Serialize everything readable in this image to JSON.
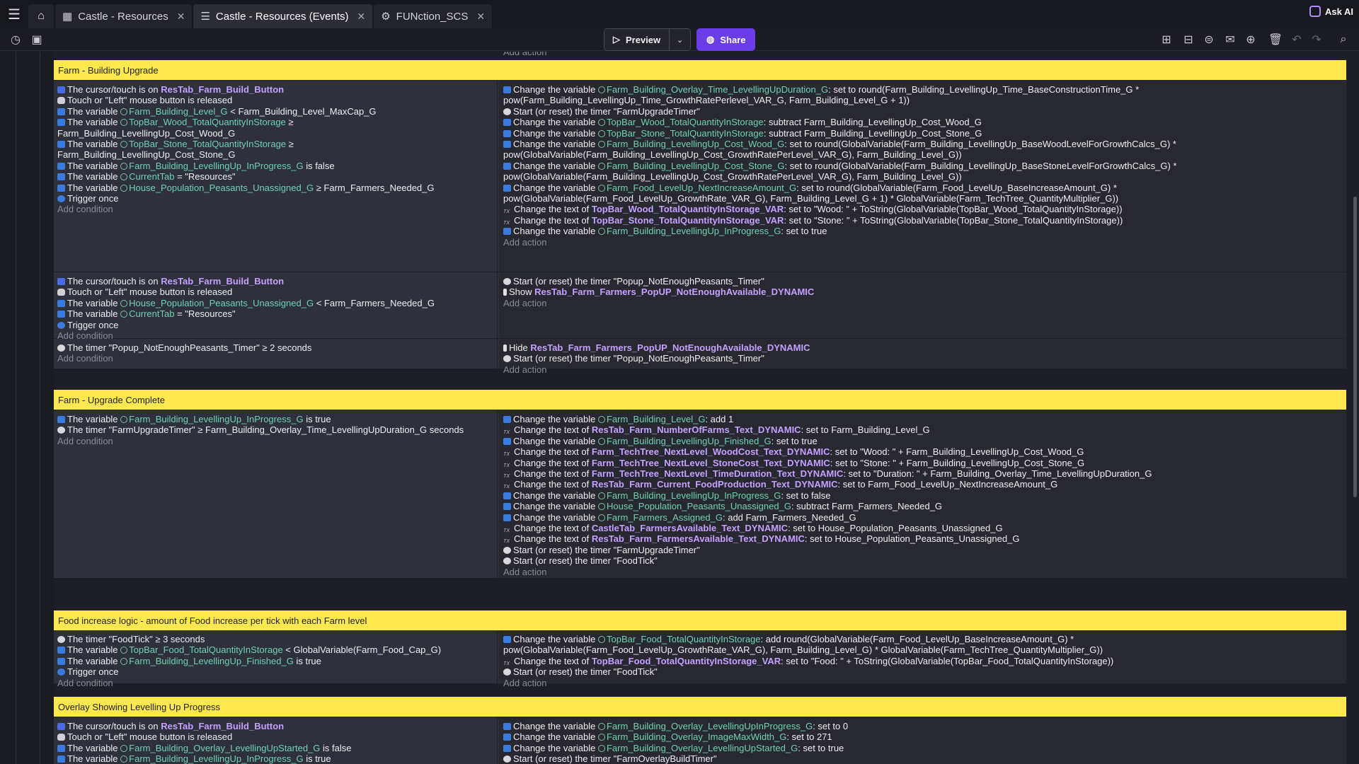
{
  "tabs": [
    {
      "label": "Castle - Resources",
      "active": false
    },
    {
      "label": "Castle - Resources (Events)",
      "active": true
    },
    {
      "label": "FUNction_SCS",
      "active": false
    }
  ],
  "header": {
    "ask_ai": "Ask AI"
  },
  "toolbar": {
    "preview": "Preview",
    "share": "Share",
    "ghost": "Add action"
  },
  "colors": {
    "comment_bg": "#fde84f",
    "share_bg": "#6a3de8",
    "object_name": "#c6a0ff",
    "variable_name": "#6fd3b0"
  },
  "events": {
    "c1": "Farm - Building Upgrade",
    "c2": "Farm - Upgrade Complete",
    "c3": "Food increase logic - amount of Food increase per tick with each Farm level",
    "c4": "Overlay Showing Levelling Up Progress",
    "e1": {
      "cond": [
        "The cursor/touch is on |ResTab_Farm_Build_Button",
        "Touch or \"Left\" mouse button is released",
        "The variable |Farm_Building_Level_G| < Farm_Building_Level_MaxCap_G",
        "The variable |TopBar_Wood_TotalQuantityInStorage| ≥",
        "Farm_Building_LevellingUp_Cost_Wood_G",
        "The variable |TopBar_Stone_TotalQuantityInStorage| ≥",
        "Farm_Building_LevellingUp_Cost_Stone_G",
        "The variable |Farm_Building_LevellingUp_InProgress_G| is false",
        "The variable |CurrentTab| = \"Resources\"",
        "The variable |House_Population_Peasants_Unassigned_G| ≥ Farm_Farmers_Needed_G",
        "Trigger once",
        "Add condition"
      ],
      "act": [
        "Change the variable |Farm_Building_Overlay_Time_LevellingUpDuration_G|: set to round(Farm_Building_LevellingUp_Time_BaseConstructionTime_G *",
        "pow(Farm_Building_LevellingUp_Time_GrowthRatePerlevel_VAR_G, Farm_Building_Level_G + 1))",
        "Start (or reset) the timer \"FarmUpgradeTimer\"",
        "Change the variable |TopBar_Wood_TotalQuantityInStorage|: subtract Farm_Building_LevellingUp_Cost_Wood_G",
        "Change the variable |TopBar_Stone_TotalQuantityInStorage|: subtract Farm_Building_LevellingUp_Cost_Stone_G",
        "Change the variable |Farm_Building_LevellingUp_Cost_Wood_G|: set to round(GlobalVariable(Farm_Building_LevellingUp_BaseWoodLevelForGrowthCalcs_G) *",
        "pow(GlobalVariable(Farm_Building_LevellingUp_Cost_GrowthRatePerLevel_VAR_G), Farm_Building_Level_G))",
        "Change the variable |Farm_Building_LevellingUp_Cost_Stone_G|: set to round(GlobalVariable(Farm_Building_LevellingUp_BaseStoneLevelForGrowthCalcs_G) *",
        "pow(GlobalVariable(Farm_Building_LevellingUp_Cost_GrowthRatePerLevel_VAR_G), Farm_Building_Level_G))",
        "Change the variable |Farm_Food_LevelUp_NextIncreaseAmount_G|: set to round(GlobalVariable(Farm_Food_LevelUp_BaseIncreaseAmount_G) *",
        "pow(GlobalVariable(Farm_Food_LevelUp_GrowthRate_VAR_G), Farm_Building_Level_G + 1) * GlobalVariable(Farm_TechTree_QuantityMultiplier_G))",
        "Change the text of |TopBar_Wood_TotalQuantityInStorage_VAR|: set to \"Wood: \" + ToString(GlobalVariable(TopBar_Wood_TotalQuantityInStorage))",
        "Change the text of |TopBar_Stone_TotalQuantityInStorage_VAR|: set to \"Stone: \" + ToString(GlobalVariable(TopBar_Stone_TotalQuantityInStorage))",
        "Change the variable |Farm_Building_LevellingUp_InProgress_G|: set to true",
        "Add action"
      ]
    },
    "e2": {
      "cond": [
        "The cursor/touch is on |ResTab_Farm_Build_Button",
        "Touch or \"Left\" mouse button is released",
        "The variable |House_Population_Peasants_Unassigned_G| < Farm_Farmers_Needed_G",
        "The variable |CurrentTab| = \"Resources\"",
        "Trigger once",
        "Add condition"
      ],
      "act": [
        "Start (or reset) the timer \"Popup_NotEnoughPeasants_Timer\"",
        "Show |ResTab_Farm_Farmers_PopUP_NotEnoughAvailable_DYNAMIC",
        "Add action"
      ]
    },
    "e3": {
      "cond": [
        "The timer \"Popup_NotEnoughPeasants_Timer\" ≥ 2 seconds",
        "Add condition"
      ],
      "act": [
        "Hide |ResTab_Farm_Farmers_PopUP_NotEnoughAvailable_DYNAMIC",
        "Start (or reset) the timer \"Popup_NotEnoughPeasants_Timer\"",
        "Add action"
      ]
    },
    "e4": {
      "cond": [
        "The variable |Farm_Building_LevellingUp_InProgress_G| is true",
        "The timer \"FarmUpgradeTimer\" ≥ Farm_Building_Overlay_Time_LevellingUpDuration_G seconds",
        "Add condition"
      ],
      "act": [
        "Change the variable |Farm_Building_Level_G|: add 1",
        "Change the text of |ResTab_Farm_NumberOfFarms_Text_DYNAMIC|: set to Farm_Building_Level_G",
        "Change the variable |Farm_Building_LevellingUp_Finished_G|: set to true",
        "Change the text of |Farm_TechTree_NextLevel_WoodCost_Text_DYNAMIC|: set to \"Wood: \" + Farm_Building_LevellingUp_Cost_Wood_G",
        "Change the text of |Farm_TechTree_NextLevel_StoneCost_Text_DYNAMIC|: set to \"Stone: \" + Farm_Building_LevellingUp_Cost_Stone_G",
        "Change the text of |Farm_TechTree_NextLevel_TimeDuration_Text_DYNAMIC|: set to \"Duration: \" + Farm_Building_Overlay_Time_LevellingUpDuration_G",
        "Change the text of |ResTab_Farm_Current_FoodProduction_Text_DYNAMIC|: set to Farm_Food_LevelUp_NextIncreaseAmount_G",
        "Change the variable |Farm_Building_LevellingUp_InProgress_G|: set to false",
        "Change the variable |House_Population_Peasants_Unassigned_G|: subtract Farm_Farmers_Needed_G",
        "Change the variable |Farm_Farmers_Assigned_G|: add Farm_Farmers_Needed_G",
        "Change the text of |CastleTab_FarmersAvailable_Text_DYNAMIC|: set to House_Population_Peasants_Unassigned_G",
        "Change the text of |ResTab_Farm_FarmersAvailable_Text_DYNAMIC|: set to House_Population_Peasants_Unassigned_G",
        "Start (or reset) the timer \"FarmUpgradeTimer\"",
        "Start (or reset) the timer \"FoodTick\"",
        "Add action"
      ]
    },
    "e5": {
      "cond": [
        "The timer \"FoodTick\" ≥ 3 seconds",
        "The variable |TopBar_Food_TotalQuantityInStorage| < GlobalVariable(Farm_Food_Cap_G)",
        "The variable |Farm_Building_LevellingUp_Finished_G| is true",
        "Trigger once",
        "Add condition"
      ],
      "act": [
        "Change the variable |TopBar_Food_TotalQuantityInStorage|: add round(GlobalVariable(Farm_Food_LevelUp_BaseIncreaseAmount_G) *",
        "pow(GlobalVariable(Farm_Food_LevelUp_GrowthRate_VAR_G), Farm_Building_Level_G) * GlobalVariable(Farm_TechTree_QuantityMultiplier_G))",
        "Change the text of |TopBar_Food_TotalQuantityInStorage_VAR|: set to \"Food: \" + ToString(GlobalVariable(TopBar_Food_TotalQuantityInStorage))",
        "Start (or reset) the timer \"FoodTick\"",
        "Add action"
      ]
    },
    "e6": {
      "cond": [
        "The cursor/touch is on |ResTab_Farm_Build_Button",
        "Touch or \"Left\" mouse button is released",
        "The variable |Farm_Building_Overlay_LevellingUpStarted_G| is false",
        "The variable |Farm_Building_LevellingUp_InProgress_G| is true"
      ],
      "act": [
        "Change the variable |Farm_Building_Overlay_LevellingUpInProgress_G|: set to 0",
        "Change the variable |Farm_Building_Overlay_ImageMaxWidth_G|: set to 271",
        "Change the variable |Farm_Building_Overlay_LevellingUpStarted_G|: set to true",
        "Start (or reset) the timer \"FarmOverlayBuildTimer\""
      ]
    }
  }
}
